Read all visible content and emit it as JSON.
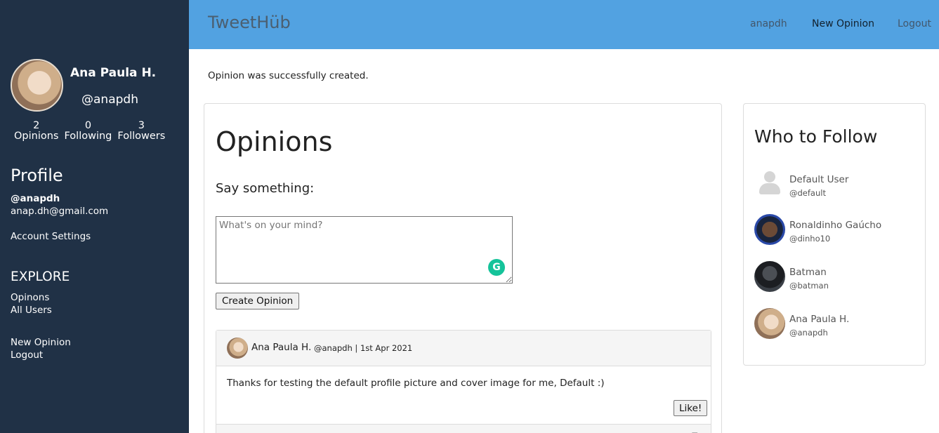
{
  "sidebar": {
    "name": "Ana Paula H.",
    "handle": "@anapdh",
    "stats": [
      {
        "count": "2",
        "label": "Opinions"
      },
      {
        "count": "0",
        "label": "Following"
      },
      {
        "count": "3",
        "label": "Followers"
      }
    ],
    "profile_title": "Profile",
    "profile_handle": "@anapdh",
    "email": "anap.dh@gmail.com",
    "account_settings": "Account Settings",
    "explore_title": "EXPLORE",
    "explore_links": [
      "Opinons",
      "All Users"
    ],
    "new_opinion": "New Opinion",
    "logout": "Logout"
  },
  "topbar": {
    "brand": "TweetHüb",
    "user": "anapdh",
    "new_opinion": "New Opinion",
    "logout": "Logout",
    "background_color": "#52a2e1"
  },
  "notice": "Opinion was successfully created.",
  "main": {
    "title": "Opinions",
    "say_something": "Say something:",
    "textarea_placeholder": "What's on your mind?",
    "create_button": "Create Opinion",
    "opinion": {
      "author": "Ana Paula H.",
      "meta": "@anapdh | 1st Apr 2021",
      "text": "Thanks for testing the default profile picture and cover image for me, Default :)",
      "like_button": "Like!"
    }
  },
  "follow": {
    "title": "Who to Follow",
    "users": [
      {
        "name": "Default User",
        "handle": "@default"
      },
      {
        "name": "Ronaldinho Gaúcho",
        "handle": "@dinho10"
      },
      {
        "name": "Batman",
        "handle": "@batman"
      },
      {
        "name": "Ana Paula H.",
        "handle": "@anapdh"
      }
    ]
  },
  "colors": {
    "sidebar": "#203146",
    "accent": "#52a2e1",
    "grammarly": "#15c39a"
  }
}
